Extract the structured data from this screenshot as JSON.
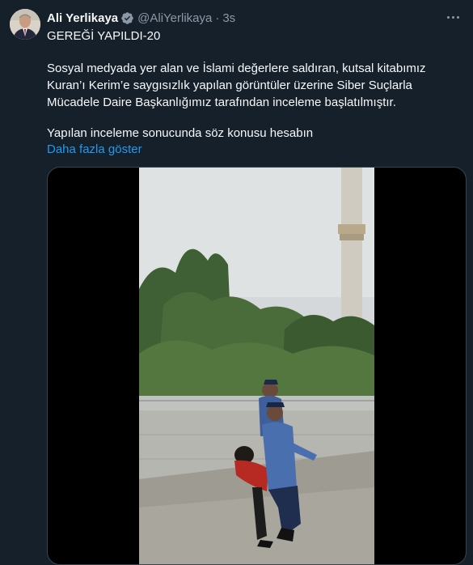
{
  "author": {
    "name": "Ali Yerlikaya",
    "handle": "@AliYerlikaya",
    "separator": "·",
    "time": "3s"
  },
  "tweet": {
    "line_title": "GEREĞİ YAPILDI-20",
    "paragraph1_line1": "Sosyal medyada yer alan ve İslami değerlere saldıran, kutsal kitabımız",
    "paragraph1_line2": "Kuran’ı Kerim’e saygısızlık yapılan görüntüler üzerine Siber Suçlarla",
    "paragraph1_line3": "Mücadele Daire Başkanlığımız tarafından inceleme başlatılmıştır.",
    "paragraph2": "Yapılan inceleme sonucunda söz konusu hesabın",
    "show_more": "Daha fazla göster"
  },
  "colors": {
    "background": "#15202b",
    "text": "#f7f9f9",
    "secondary": "#8b98a5",
    "link": "#1d9bf0",
    "verified": "#8b98a5"
  },
  "icons": [
    "verified-badge-icon",
    "more-options-icon"
  ]
}
